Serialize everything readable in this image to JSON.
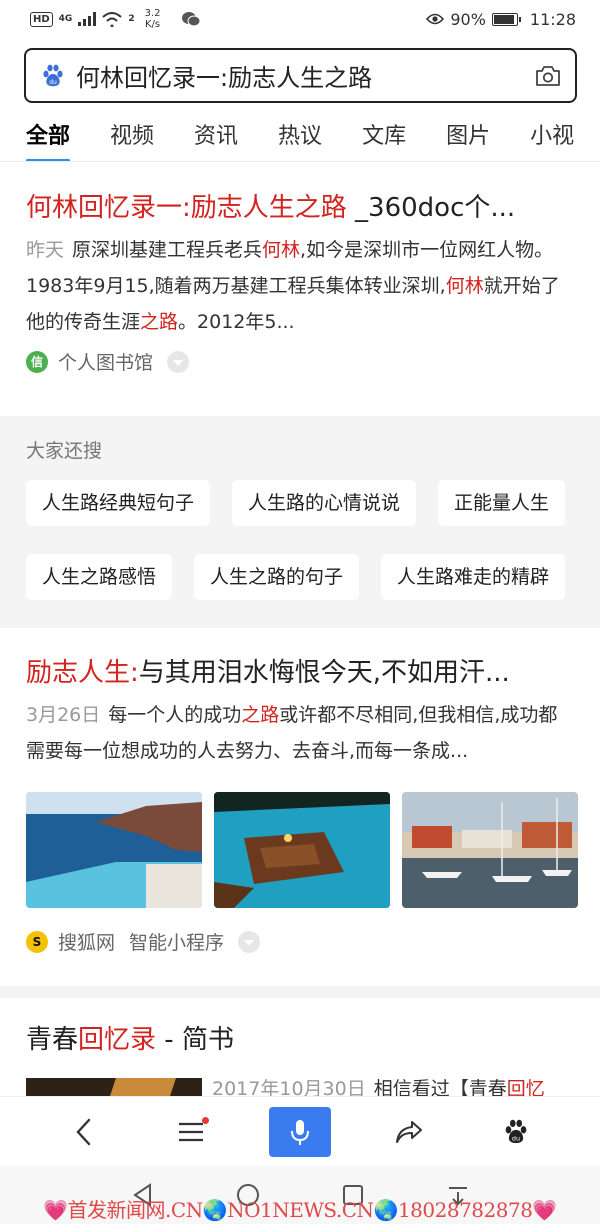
{
  "status_bar": {
    "hd": "HD",
    "network": "4G",
    "wifi_label": "2",
    "speed_value": "3.2",
    "speed_unit": "K/s",
    "battery_percent": "90%",
    "battery_level": 0.9,
    "time": "11:28"
  },
  "search": {
    "query": "何林回忆录一:励志人生之路"
  },
  "tabs": [
    "全部",
    "视频",
    "资讯",
    "热议",
    "文库",
    "图片",
    "小视"
  ],
  "result1": {
    "title_hl": "何林回忆录一:励志人生之路",
    "title_rest": " _360doc个...",
    "date": "昨天",
    "abs1": "原深圳基建工程兵老兵",
    "abs_hl1": "何林",
    "abs2": ",如今是深圳市一位网红人物。1983年9月15,随着两万基建工程兵集体转业深圳,",
    "abs_hl2": "何林",
    "abs3": "就开始了他的传奇生涯",
    "abs_hl3": "之路",
    "abs4": "。2012年5...",
    "source": "个人图书馆",
    "source_icon_text": "信"
  },
  "related": {
    "title": "大家还搜",
    "row1": [
      "人生路经典短句子",
      "人生路的心情说说",
      "正能量人生"
    ],
    "row2": [
      "人生之路感悟",
      "人生之路的句子",
      "人生路难走的精辟"
    ]
  },
  "result2": {
    "title_hl": "励志人生:",
    "title_rest": "与其用泪水悔恨今天,不如用汗...",
    "date": "3月26日",
    "abs1": "每一个人的成功",
    "abs_hl1": "之路",
    "abs2": "或许都不尽相同,但我相信,成功都需要每一位想成功的人去努力、去奋斗,而每一条成...",
    "source": "搜狐网",
    "source_extra": "智能小程序",
    "source_icon_text": "S"
  },
  "result3": {
    "title1": "青春",
    "title_hl": "回忆录",
    "title2": " - 简书",
    "date": "2017年10月30日",
    "abs1": "相信看过【青春",
    "abs_hl1": "回忆"
  },
  "watermark": "💗首发新闻网.CN🌏NO1NEWS.CN🌏18028782878💗"
}
